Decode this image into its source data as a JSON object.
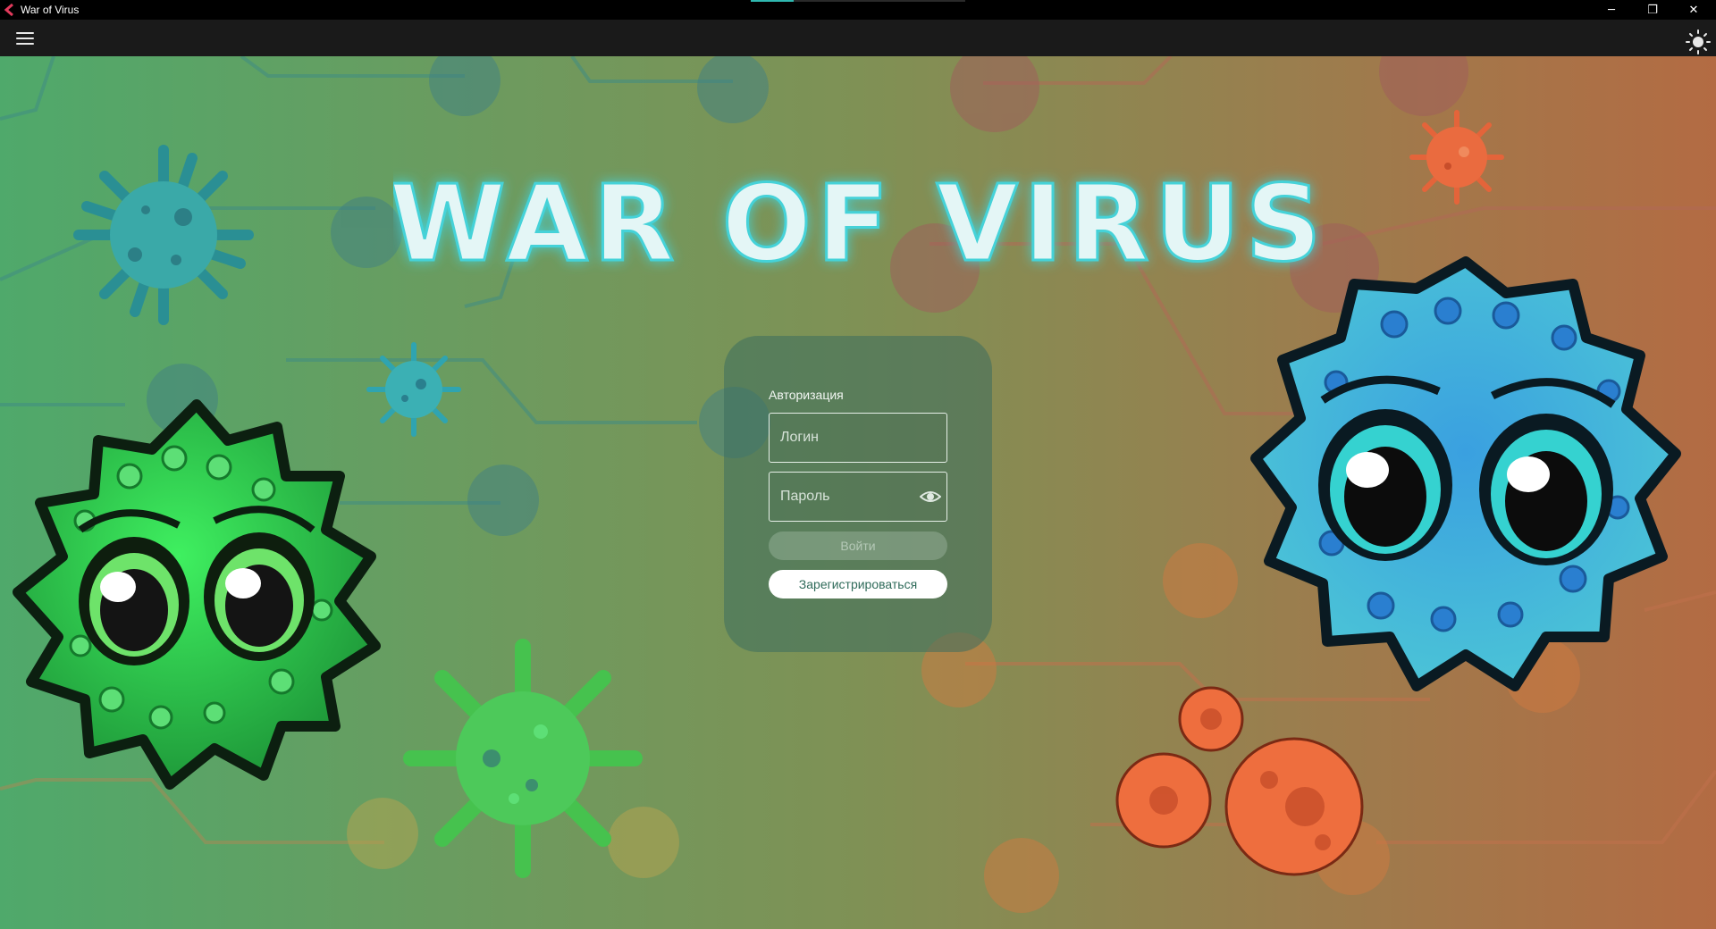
{
  "window": {
    "title": "War of Virus",
    "loading_progress": 0.2,
    "controls": {
      "minimize": "─",
      "maximize": "❐",
      "close": "✕"
    }
  },
  "toolbar": {
    "menu_icon": "hamburger-menu-icon",
    "theme_icon": "sun-icon"
  },
  "hero": {
    "game_title": "WAR OF VIRUS"
  },
  "auth": {
    "heading": "Авторизация",
    "login_placeholder": "Логин",
    "login_value": "",
    "password_placeholder": "Пароль",
    "password_value": "",
    "password_toggle_icon": "eye-icon",
    "login_button": "Войти",
    "register_button": "Зарегистрироваться"
  },
  "colors": {
    "title_fill": "#e4f6f6",
    "title_glow": "#44d2d8",
    "panel": "#3c6e5f",
    "register_text": "#2f6b5a"
  }
}
